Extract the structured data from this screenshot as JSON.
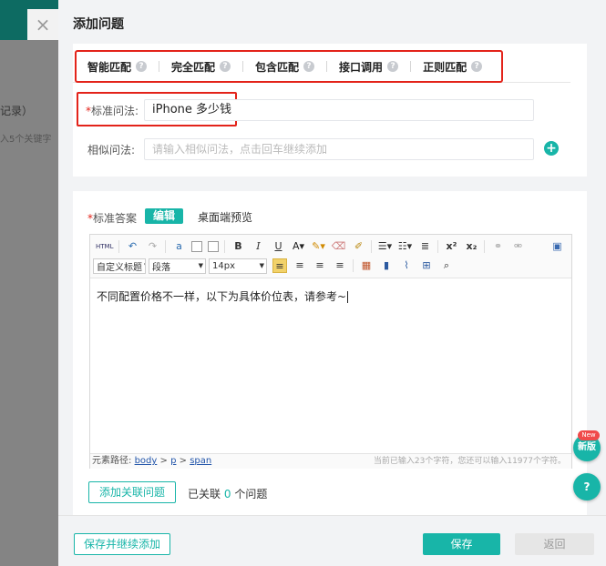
{
  "background": {
    "close_glyph": "×",
    "text_1": "记录）",
    "text_2": "入5个关键字"
  },
  "dialog": {
    "title": "添加问题"
  },
  "match_tabs": [
    {
      "label": "智能匹配",
      "help": "?"
    },
    {
      "label": "完全匹配",
      "help": "?"
    },
    {
      "label": "包含匹配",
      "help": "?"
    },
    {
      "label": "接口调用",
      "help": "?"
    },
    {
      "label": "正则匹配",
      "help": "?"
    }
  ],
  "standard_question": {
    "required_mark": "*",
    "label": "标准问法:",
    "value": "iPhone 多少钱"
  },
  "similar_question": {
    "label": "相似问法:",
    "placeholder": "请输入相似问法，点击回车继续添加",
    "add_glyph": "+"
  },
  "answer": {
    "required_mark": "*",
    "label": "标准答案",
    "edit_tab": "编辑",
    "preview_tab": "桌面端预览"
  },
  "editor": {
    "toolbar_row1": [
      "HTML",
      "↶",
      "↷",
      "a",
      "",
      "",
      "B",
      "I",
      "U",
      "A",
      "",
      "",
      "",
      "",
      "",
      "",
      "x²",
      "x₂",
      "",
      "",
      ""
    ],
    "font_family_select": "自定义标题",
    "paragraph_select": "段落",
    "font_size_select": "14px",
    "content": "不同配置价格不一样，以下为具体价位表，请参考~",
    "path_label": "元素路径:",
    "path_items": [
      "body",
      "p",
      "span"
    ],
    "path_sep": ">",
    "char_count": "当前已输入23个字符，您还可以输入11977个字符。"
  },
  "related": {
    "button_label": "添加关联问题",
    "linked_prefix": "已关联",
    "linked_count": "0",
    "linked_suffix": "个问题"
  },
  "footer": {
    "save_and_add_label": "保存并继续添加",
    "save_label": "保存",
    "back_label": "返回"
  },
  "floating": {
    "new_badge": "New",
    "new_version_label": "新版",
    "help_glyph": "?"
  },
  "colors": {
    "accent": "#18b5a8",
    "highlight_red": "#e3231a",
    "link_blue": "#2255aa"
  }
}
